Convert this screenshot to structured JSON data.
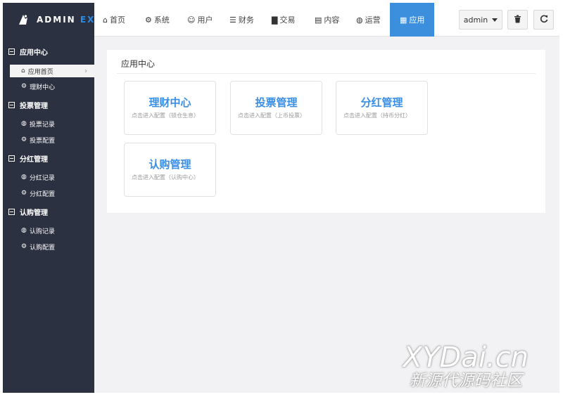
{
  "brand": {
    "text_main": "ADMIN",
    "text_accent": "EX"
  },
  "topnav": [
    {
      "label": "首页",
      "icon": "home-icon",
      "glyph": "⌂"
    },
    {
      "label": "系统",
      "icon": "gear-icon",
      "glyph": "⚙"
    },
    {
      "label": "用户",
      "icon": "user-icon",
      "glyph": "☺"
    },
    {
      "label": "财务",
      "icon": "list-icon",
      "glyph": "☰"
    },
    {
      "label": "交易",
      "icon": "bar-chart-icon",
      "glyph": "▇"
    },
    {
      "label": "内容",
      "icon": "document-icon",
      "glyph": "▤"
    },
    {
      "label": "运营",
      "icon": "globe-icon",
      "glyph": "◍"
    },
    {
      "label": "应用",
      "icon": "grid-icon",
      "glyph": "▦"
    }
  ],
  "user_menu": {
    "label": "admin"
  },
  "toolbar": {
    "trash_icon": "trash-icon",
    "refresh_icon": "refresh-icon"
  },
  "sidebar": {
    "groups": [
      {
        "label": "应用中心",
        "items": [
          {
            "label": "应用首页",
            "icon": "home-icon",
            "glyph": "⌂"
          },
          {
            "label": "理财中心",
            "icon": "gear-icon",
            "glyph": "⚙"
          }
        ]
      },
      {
        "label": "投票管理",
        "items": [
          {
            "label": "投票记录",
            "icon": "globe-icon",
            "glyph": "◍"
          },
          {
            "label": "投票配置",
            "icon": "gear-icon",
            "glyph": "⚙"
          }
        ]
      },
      {
        "label": "分红管理",
        "items": [
          {
            "label": "分红记录",
            "icon": "globe-icon",
            "glyph": "◍"
          },
          {
            "label": "分红配置",
            "icon": "gear-icon",
            "glyph": "⚙"
          }
        ]
      },
      {
        "label": "认购管理",
        "items": [
          {
            "label": "认购记录",
            "icon": "globe-icon",
            "glyph": "◍"
          },
          {
            "label": "认购配置",
            "icon": "gear-icon",
            "glyph": "⚙"
          }
        ]
      }
    ]
  },
  "main": {
    "title": "应用中心",
    "cards": [
      {
        "title": "理财中心",
        "subtitle": "点击进入配置（锁仓生息）"
      },
      {
        "title": "投票管理",
        "subtitle": "点击进入配置（上币投票）"
      },
      {
        "title": "分红管理",
        "subtitle": "点击进入配置（持币分红）"
      },
      {
        "title": "认购管理",
        "subtitle": "点击进入配置（认购中心）"
      }
    ]
  },
  "watermark": {
    "line1": "XYDai.cn",
    "line2": "新源代源码社区"
  },
  "colors": {
    "sidebar_bg": "#2b3140",
    "accent": "#3c8fdd",
    "card_title": "#3a8ee6"
  }
}
